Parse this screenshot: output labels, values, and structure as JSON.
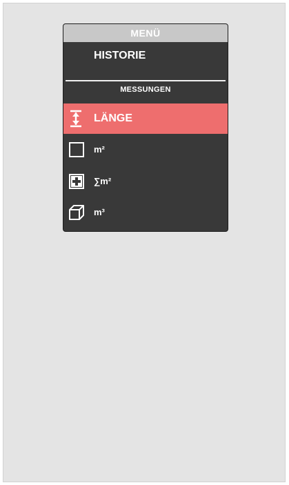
{
  "menu": {
    "title": "MENÜ",
    "history_label": "HISTORIE",
    "section_title": "MESSUNGEN",
    "items": [
      {
        "label": "LÄNGE",
        "icon": "length-icon",
        "active": true
      },
      {
        "label": "m²",
        "icon": "area-icon",
        "active": false
      },
      {
        "label": "∑m²",
        "icon": "area-sum-icon",
        "active": false
      },
      {
        "label": "m³",
        "icon": "volume-icon",
        "active": false
      }
    ]
  },
  "colors": {
    "panel_bg": "#393939",
    "header_bg": "#c8c8c8",
    "active_bg": "#ee6e6e",
    "screen_bg": "#e4e4e4",
    "text": "#ffffff"
  }
}
